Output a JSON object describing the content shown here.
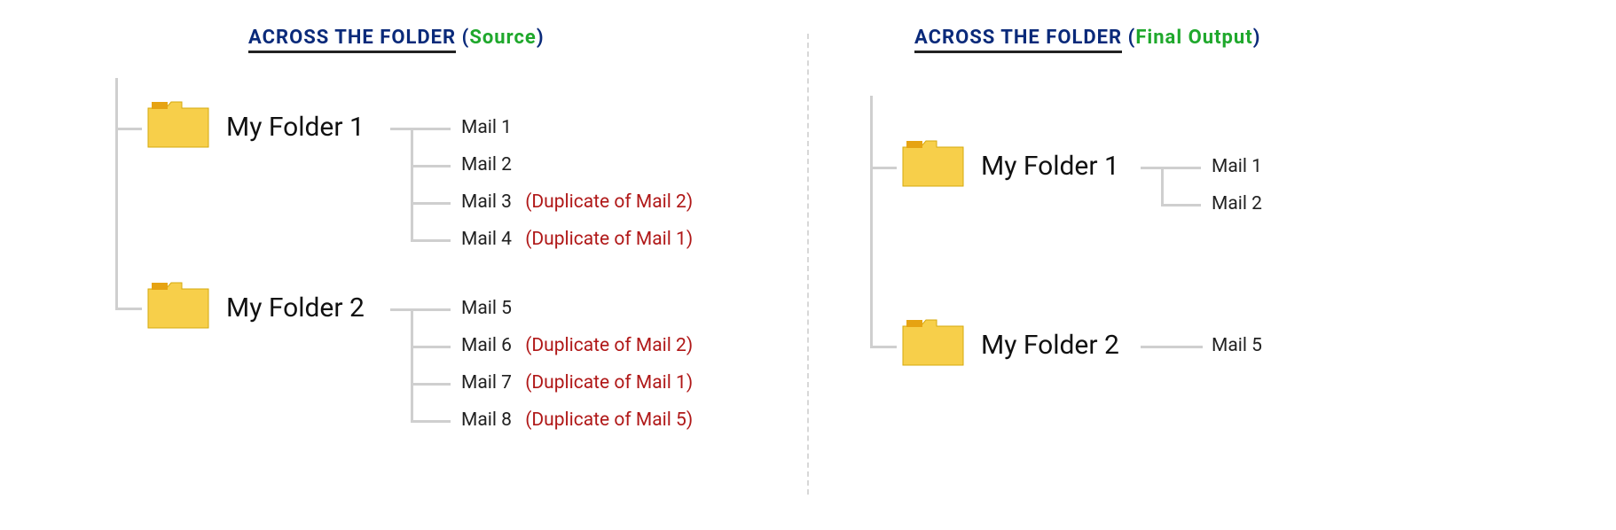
{
  "left": {
    "heading_main": "ACROSS THE FOLDER",
    "heading_sub": "Source",
    "folders": [
      {
        "name": "My Folder 1",
        "mails": [
          {
            "name": "Mail 1",
            "note": ""
          },
          {
            "name": "Mail 2",
            "note": ""
          },
          {
            "name": "Mail 3",
            "note": "(Duplicate of Mail 2)"
          },
          {
            "name": "Mail 4",
            "note": "(Duplicate of Mail 1)"
          }
        ]
      },
      {
        "name": "My Folder 2",
        "mails": [
          {
            "name": "Mail 5",
            "note": ""
          },
          {
            "name": "Mail 6",
            "note": "(Duplicate of Mail 2)"
          },
          {
            "name": "Mail 7",
            "note": "(Duplicate of Mail 1)"
          },
          {
            "name": "Mail 8",
            "note": "(Duplicate of Mail 5)"
          }
        ]
      }
    ]
  },
  "right": {
    "heading_main": "ACROSS THE FOLDER",
    "heading_sub": "Final Output",
    "folders": [
      {
        "name": "My Folder 1",
        "mails": [
          {
            "name": "Mail 1",
            "note": ""
          },
          {
            "name": "Mail 2",
            "note": ""
          }
        ]
      },
      {
        "name": "My Folder 2",
        "mails": [
          {
            "name": "Mail 5",
            "note": ""
          }
        ]
      }
    ]
  }
}
